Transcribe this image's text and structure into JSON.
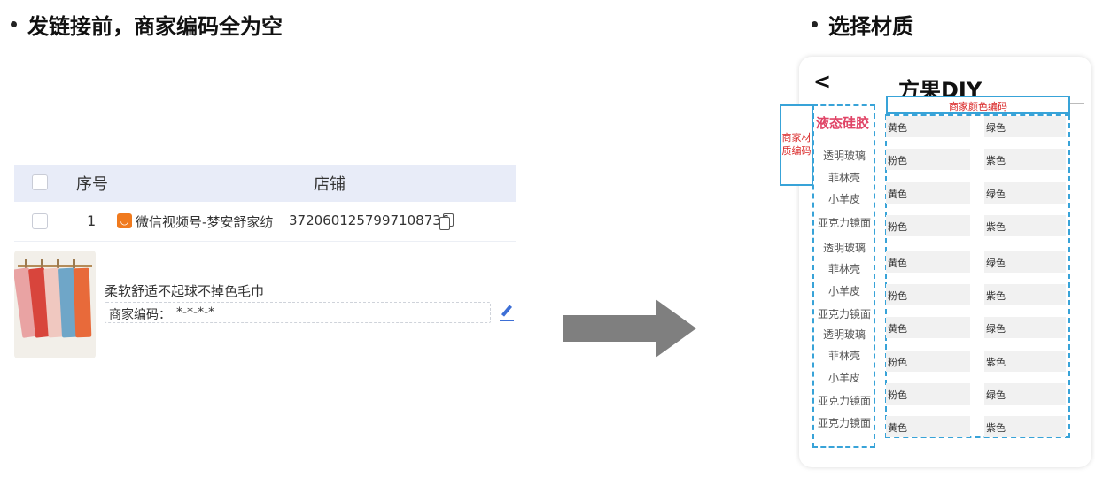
{
  "headings": {
    "left": "发链接前，商家编码全为空",
    "right": "选择材质"
  },
  "table": {
    "header": {
      "no": "序号",
      "shop": "店铺"
    },
    "row": {
      "no": "1",
      "shop_name": "微信视频号-梦安舒家纺",
      "order_id": "3720601257997108736"
    }
  },
  "product": {
    "name": "柔软舒适不起球不掉色毛巾",
    "code_label": "商家编码：",
    "code_value": "*-*-*-*"
  },
  "phone": {
    "back": "<",
    "title": "方果DIY",
    "material_code_label": "商家材质编码",
    "color_code_label": "商家颜色编码",
    "selected_material": "液态硅胶",
    "materials": [
      "透明玻璃",
      "菲林壳",
      "小羊皮",
      "亚克力镜面",
      "透明玻璃",
      "菲林壳",
      "小羊皮",
      "亚克力镜面",
      "透明玻璃",
      "菲林壳",
      "小羊皮",
      "亚克力镜面",
      "亚克力镜面"
    ],
    "color_rows": [
      [
        "黄色",
        "绿色"
      ],
      [
        "粉色",
        "紫色"
      ],
      [
        "黄色",
        "绿色"
      ],
      [
        "粉色",
        "紫色"
      ],
      [
        "黄色",
        "绿色"
      ],
      [
        "粉色",
        "紫色"
      ],
      [
        "黄色",
        "绿色"
      ],
      [
        "粉色",
        "紫色"
      ],
      [
        "粉色",
        "绿色"
      ],
      [
        "黄色",
        "紫色"
      ]
    ]
  },
  "colors": {
    "header_bg": "#e8ecf8",
    "dash_blue": "#38a3d8",
    "label_red": "#d92626",
    "selected_pink": "#e04466",
    "arrow_gray": "#7f7f7f",
    "edit_blue": "#3d6fd6"
  }
}
